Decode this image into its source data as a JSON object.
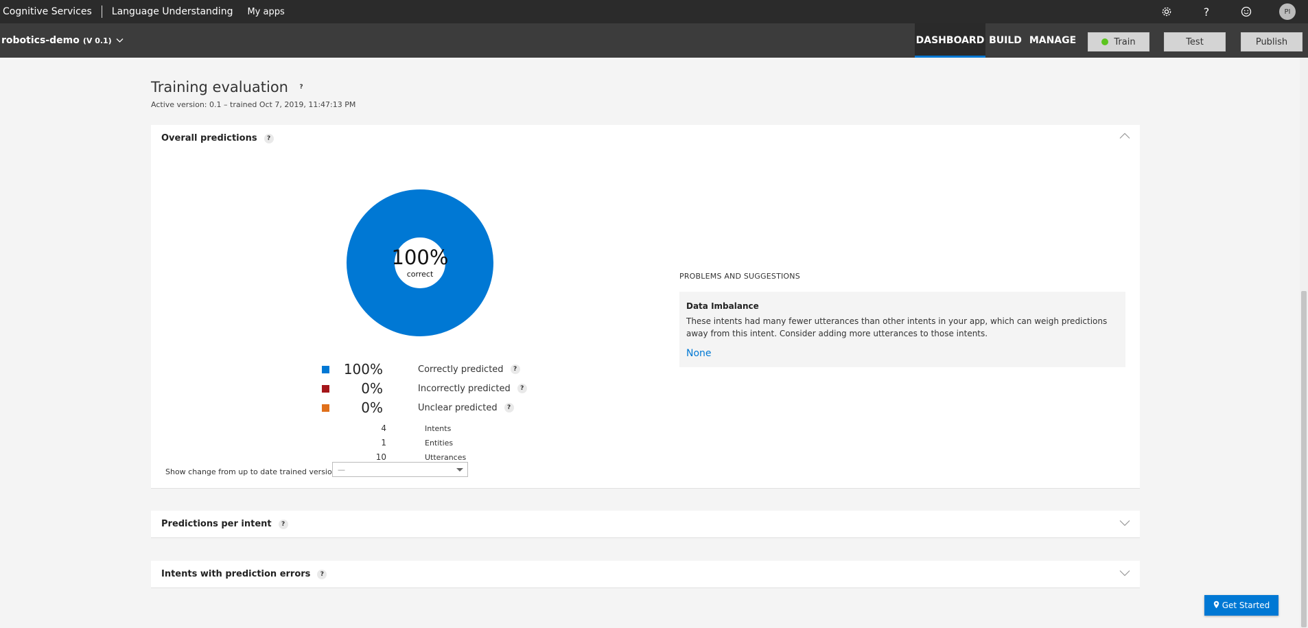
{
  "topbar": {
    "brand": "Cognitive Services",
    "product": "Language Understanding",
    "my_apps": "My apps",
    "icons": [
      "gear-icon",
      "help-icon",
      "smiley-icon"
    ],
    "help_glyph": "?",
    "avatar_initials": "PI"
  },
  "appbar": {
    "app_name": "robotics-demo",
    "version": "(V 0.1)",
    "tabs": [
      {
        "label": "DASHBOARD",
        "active": true
      },
      {
        "label": "BUILD",
        "active": false
      },
      {
        "label": "MANAGE",
        "active": false
      }
    ],
    "train_label": "Train",
    "test_label": "Test",
    "publish_label": "Publish"
  },
  "page": {
    "title": "Training evaluation",
    "help_glyph": "?",
    "active_version": "Active version: 0.1 – trained Oct 7, 2019, 11:47:13 PM"
  },
  "overall": {
    "title": "Overall predictions",
    "help_glyph": "?",
    "donut_pct": "100%",
    "donut_label": "correct",
    "correct_fraction": 1.0,
    "legend": [
      {
        "value": "100%",
        "label": "Correctly predicted",
        "color": "#0078d4"
      },
      {
        "value": "0%",
        "label": "Incorrectly predicted",
        "color": "#a4161a"
      },
      {
        "value": "0%",
        "label": "Unclear predicted",
        "color": "#e0701b"
      }
    ],
    "counts": [
      {
        "value": "4",
        "label": "Intents"
      },
      {
        "value": "1",
        "label": "Entities"
      },
      {
        "value": "10",
        "label": "Utterances"
      }
    ],
    "show_change_label": "Show change from up to date trained version:",
    "show_change_value": "—"
  },
  "problems": {
    "title": "PROBLEMS AND SUGGESTIONS",
    "item_title": "Data Imbalance",
    "item_text": "These intents had many fewer utterances than other intents in your app, which can weigh predictions away from this intent. Consider adding more utterances to those intents.",
    "item_link": "None"
  },
  "sections": [
    {
      "title": "Predictions per intent"
    },
    {
      "title": "Intents with prediction errors"
    }
  ],
  "get_started": "Get Started",
  "colors": {
    "accent": "#0078d4",
    "topbar": "#2b2b2b",
    "appbar": "#3c3c3c",
    "train_dot": "#5cc41f"
  }
}
